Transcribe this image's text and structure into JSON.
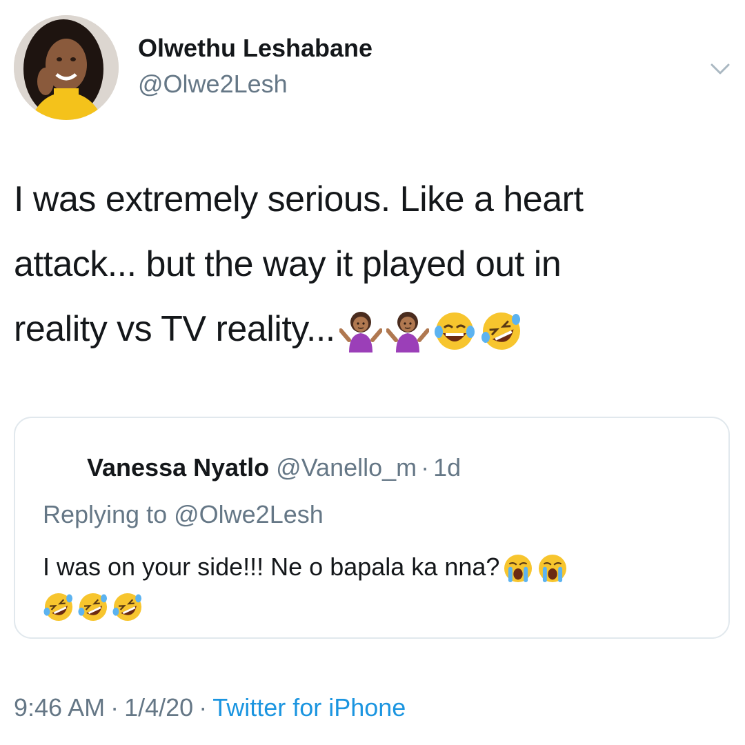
{
  "author": {
    "name": "Olwethu Leshabane",
    "handle": "@Olwe2Lesh",
    "avatar_icon": "profile-photo"
  },
  "tweet": {
    "lines": [
      "I was extremely serious. Like a heart",
      "attack... but the way it played out in",
      "reality vs TV reality..."
    ],
    "emojis": [
      "shrug-woman-emoji",
      "shrug-woman-emoji",
      "tears-of-joy-emoji",
      "rolling-laughing-emoji"
    ]
  },
  "quoted": {
    "name": "Vanessa Nyatlo",
    "handle": "@Vanello_m",
    "separator": "·",
    "time": "1d",
    "replying": "Replying to @Olwe2Lesh",
    "text": "I was on your side!!! Ne o bapala ka nna?",
    "emojis_line1": [
      "loudly-crying-emoji",
      "loudly-crying-emoji"
    ],
    "emojis_line2": [
      "rolling-laughing-emoji",
      "rolling-laughing-emoji",
      "rolling-laughing-emoji"
    ]
  },
  "footer": {
    "time": "9:46 AM",
    "date": "1/4/20",
    "separator": "·",
    "source": "Twitter for iPhone"
  },
  "colors": {
    "text": "#14171a",
    "secondary": "#657786",
    "link": "#1b95e0",
    "border": "#e1e8ed",
    "emoji_yellow": "#f7c52e",
    "shirt_purple": "#9b3fb8"
  }
}
